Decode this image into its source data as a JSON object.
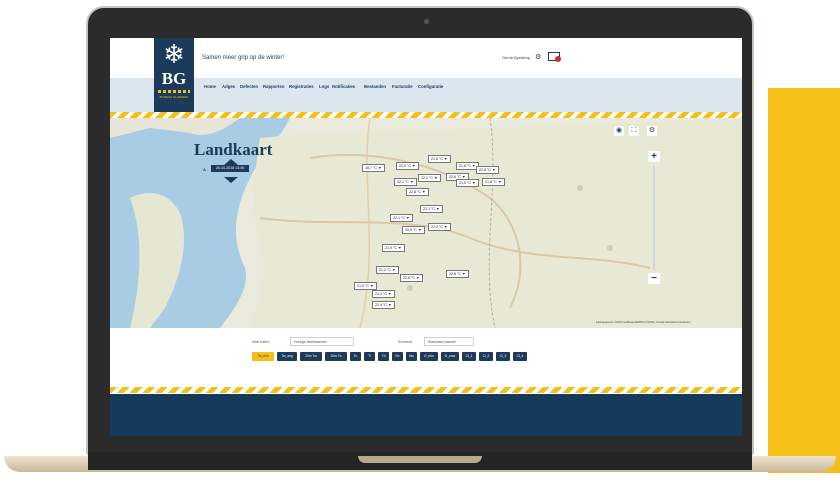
{
  "app": {
    "tagline": "Samen meer grip op de winter!",
    "user_name": "Gerrie Apeldrop",
    "logo_text": "BG",
    "logo_subtitle": "BUREAU GLADHEID"
  },
  "nav": {
    "items": [
      "Home",
      "Adges",
      "Defecten",
      "Rapporten",
      "Registraties",
      "Logs",
      "Notificaties",
      "Bestanden",
      "Facturatie",
      "Configuratie"
    ]
  },
  "map": {
    "title": "Landkaart",
    "date_prefix": "A",
    "date_value": "25-10-2018 13:40",
    "attribution": "Kaartgegevens ©2018 GeoBasis-DE/BKG (©2009), Google   Gebruiksvoorwaarden",
    "markers": [
      {
        "label": "16,7 °C ▼"
      },
      {
        "label": "22,1 °C ▼"
      },
      {
        "label": "22,0 °C ▼"
      },
      {
        "label": "21,6 °C ▼"
      },
      {
        "label": "22,1 °C ▼"
      },
      {
        "label": "22,6 °C ▼"
      },
      {
        "label": "21,6 °C ▼"
      },
      {
        "label": "22,6 °C ▼"
      },
      {
        "label": "21,5 °C ▼"
      },
      {
        "label": "21,8 °C ▼"
      },
      {
        "label": "22,8 °C ▼"
      },
      {
        "label": "22,1 °C ▼"
      },
      {
        "label": "22,1 °C ▼"
      },
      {
        "label": "20,9 °C ▼"
      },
      {
        "label": "22,0 °C ▼"
      },
      {
        "label": "21,9 °C ▼"
      },
      {
        "label": "21,2 °C ▼"
      },
      {
        "label": "21,0 °C ▼"
      },
      {
        "label": "22,6 °C ▼"
      },
      {
        "label": "22,8 °C ▼"
      },
      {
        "label": "21,3 °C ▼"
      },
      {
        "label": "22,4 °C ▼"
      }
    ]
  },
  "filters": {
    "label1": "Wat zullen",
    "select1": "Huidige Meetwaarden",
    "label2": "Eenheid",
    "select2": "Standaard waarde",
    "pills": [
      "Tw_min",
      "Tw_avg",
      "20m Tw",
      "20m Tu",
      "Tu",
      "Tl",
      "Td",
      "Rv",
      "Nw",
      "G_min",
      "G_max",
      "Cl_1",
      "Cl_2",
      "Cl_3",
      "Cl_4"
    ]
  },
  "device": {
    "brand": "MacBook"
  },
  "colors": {
    "navy": "#1c3b5a",
    "accent": "#f4bf17"
  }
}
